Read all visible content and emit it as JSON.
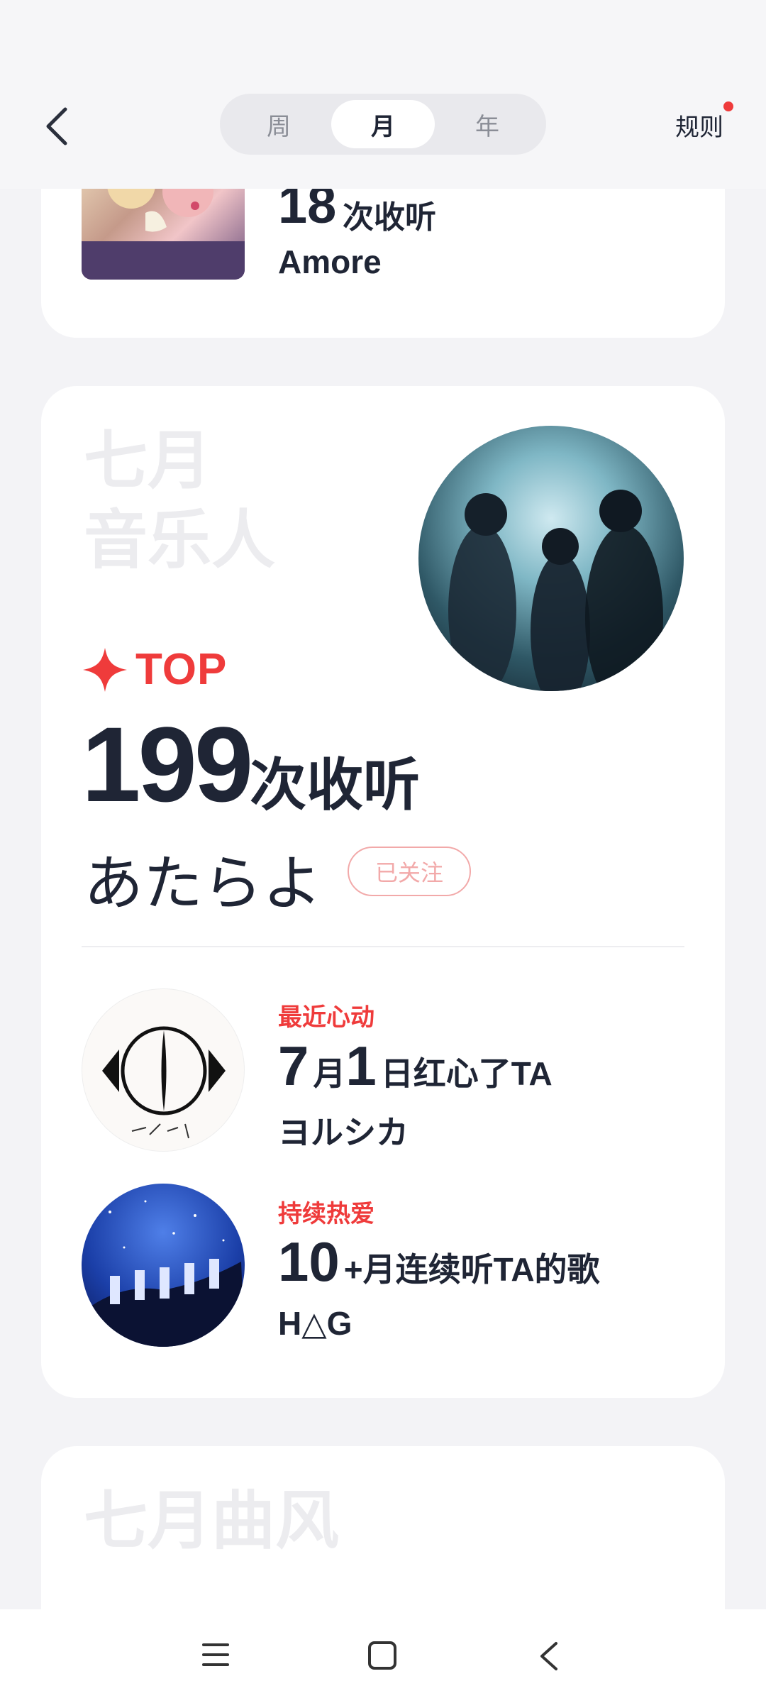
{
  "header": {
    "tabs": [
      {
        "label": "周",
        "active": false
      },
      {
        "label": "月",
        "active": true
      },
      {
        "label": "年",
        "active": false
      }
    ],
    "rules_label": "规则",
    "back_icon": "chevron-left-icon"
  },
  "top_song_card": {
    "count": "18",
    "count_unit": "次收听",
    "song_name": "Amore"
  },
  "musician_card": {
    "watermark_line1": "七月",
    "watermark_line2": "音乐人",
    "top_label": "TOP",
    "count": "199",
    "count_unit": "次收听",
    "artist_name": "あたらよ",
    "follow_label": "已关注",
    "highlights": [
      {
        "label": "最近心动",
        "month": "7",
        "month_unit": "月",
        "day": "1",
        "tail": "日红心了TA",
        "artist": "ヨルシカ"
      },
      {
        "label": "持续热爱",
        "number": "10",
        "tail": "+月连续听TA的歌",
        "artist": "H△G"
      }
    ]
  },
  "genre_card": {
    "watermark": "七月曲风"
  },
  "colors": {
    "accent": "#ef3b3b",
    "text": "#1f2535",
    "follow_outline": "#f2a9a9",
    "background": "#f3f3f6"
  },
  "navbar": {
    "icons": [
      "menu-icon",
      "home-square-icon",
      "back-triangle-icon"
    ]
  }
}
